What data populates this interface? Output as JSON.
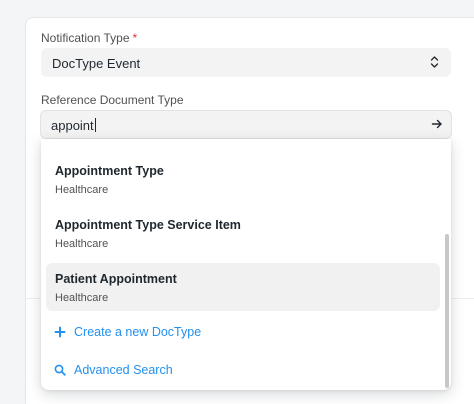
{
  "form": {
    "notification_type": {
      "label": "Notification Type",
      "required_mark": "*",
      "value": "DocType Event"
    },
    "reference_doctype": {
      "label": "Reference Document Type",
      "value": "appoint"
    }
  },
  "dropdown": {
    "options": [
      {
        "title": "Appointment Type",
        "subtitle": "Healthcare"
      },
      {
        "title": "Appointment Type Service Item",
        "subtitle": "Healthcare"
      },
      {
        "title": "Patient Appointment",
        "subtitle": "Healthcare"
      }
    ],
    "actions": {
      "create": "Create a new DocType",
      "search": "Advanced Search"
    }
  },
  "icons": {
    "select": "up-down-chevron-icon",
    "input": "arrow-right-icon",
    "create": "plus-icon",
    "search": "search-icon"
  },
  "colors": {
    "accent": "#2490ef",
    "required": "#e03636"
  }
}
